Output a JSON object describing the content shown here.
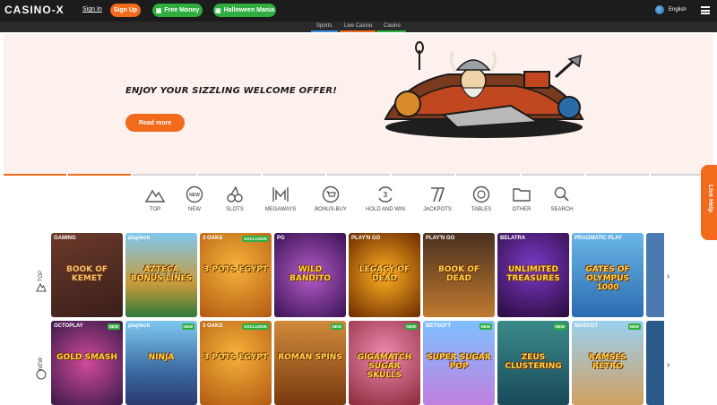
{
  "header": {
    "logo": "CASINO-X",
    "signin": "Sign In",
    "signup": "Sign Up",
    "free_money": "Free Money",
    "halloween": "Halloween Mania",
    "language": "English"
  },
  "subnav": {
    "items": [
      "Sports",
      "Live Casino",
      "Casino"
    ]
  },
  "hero": {
    "title": "ENJOY YOUR SIZZLING WELCOME OFFER!",
    "button": "Read more"
  },
  "categories": [
    "TOP",
    "NEW",
    "SLOTS",
    "MEGAWAYS",
    "BONUS-BUY",
    "HOLD AND WIN",
    "JACKPOTS",
    "TABLES",
    "OTHER",
    "SEARCH"
  ],
  "live_help": "Live Help",
  "rows": [
    {
      "label": "TOP",
      "tiles": [
        {
          "provider": "GAMING",
          "title": "BOOK OF KEMET",
          "badge": ""
        },
        {
          "provider": "playtech",
          "title": "AZTECA BONUS LINES",
          "badge": ""
        },
        {
          "provider": "3 OAKS",
          "title": "3 POTS EGYPT",
          "badge": "EXCLUSIVE"
        },
        {
          "provider": "PG",
          "title": "WILD BANDITO",
          "badge": ""
        },
        {
          "provider": "PLAY'N GO",
          "title": "LEGACY OF DEAD",
          "badge": ""
        },
        {
          "provider": "PLAY'N GO",
          "title": "BOOK OF DEAD",
          "badge": ""
        },
        {
          "provider": "BELATRA",
          "title": "UNLIMITED TREASURES",
          "badge": ""
        },
        {
          "provider": "PRAGMATIC PLAY",
          "title": "GATES OF OLYMPUS 1000",
          "badge": ""
        }
      ]
    },
    {
      "label": "NEW",
      "tiles": [
        {
          "provider": "OCTOPLAY",
          "title": "GOLD SMASH",
          "badge": "NEW"
        },
        {
          "provider": "playtech",
          "title": "NINJA",
          "badge": "NEW"
        },
        {
          "provider": "3 OAKS",
          "title": "3 POTS EGYPT",
          "badge": "EXCLUSIVE"
        },
        {
          "provider": "",
          "title": "ROMAN SPINS",
          "badge": "NEW"
        },
        {
          "provider": "",
          "title": "GIGAMATCH SUGAR SKULLS",
          "badge": "NEW"
        },
        {
          "provider": "BETSOFT",
          "title": "SUPER SUGAR POP",
          "badge": "NEW"
        },
        {
          "provider": "",
          "title": "ZEUS CLUSTERING",
          "badge": "NEW"
        },
        {
          "provider": "MASCOT",
          "title": "RAMSES RETRO",
          "badge": "NEW"
        }
      ]
    }
  ],
  "colors": {
    "accent": "#f26a1b",
    "green": "#2fae3f",
    "topbar": "#1c1c1c",
    "hero_bg": "#fdf1ee"
  }
}
